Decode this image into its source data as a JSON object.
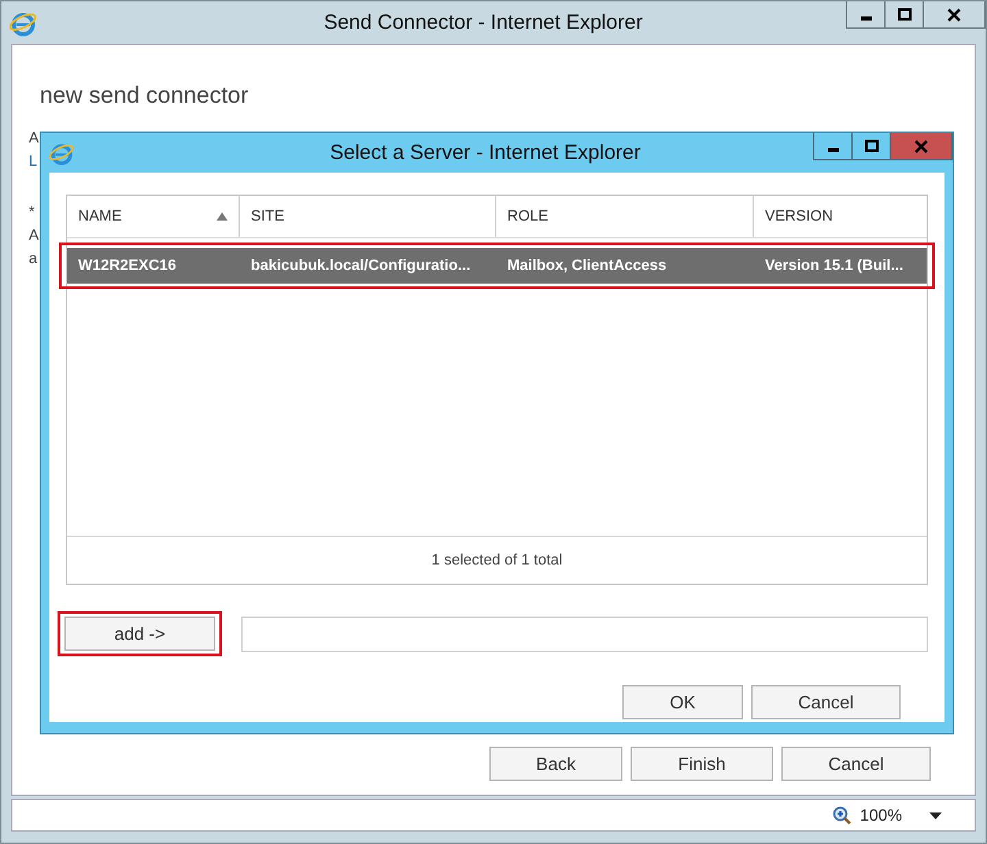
{
  "window": {
    "title": "Send Connector - Internet Explorer"
  },
  "page": {
    "heading": "new send connector",
    "fragments": [
      {
        "text": "A",
        "kind": "text"
      },
      {
        "text": "L",
        "kind": "link"
      },
      {
        "text": "*",
        "kind": "text"
      },
      {
        "text": "A",
        "kind": "text"
      },
      {
        "text": "a",
        "kind": "text"
      }
    ]
  },
  "dialog": {
    "title": "Select a Server - Internet Explorer",
    "table": {
      "columns": [
        {
          "label": "NAME",
          "sorted": true
        },
        {
          "label": "SITE",
          "sorted": false
        },
        {
          "label": "ROLE",
          "sorted": false
        },
        {
          "label": "VERSION",
          "sorted": false
        }
      ],
      "rows": [
        {
          "cells": [
            "W12R2EXC16",
            "bakicubuk.local/Configuratio...",
            "Mailbox, ClientAccess",
            "Version 15.1 (Buil..."
          ],
          "selected": true,
          "highlighted": true
        }
      ],
      "footer": "1 selected of 1 total"
    },
    "add_button": {
      "label": "add ->",
      "highlighted": true
    },
    "buttons": [
      "OK",
      "Cancel"
    ]
  },
  "buttons": [
    "Back",
    "Finish",
    "Cancel"
  ],
  "status_bar": {
    "zoom": "100%"
  }
}
